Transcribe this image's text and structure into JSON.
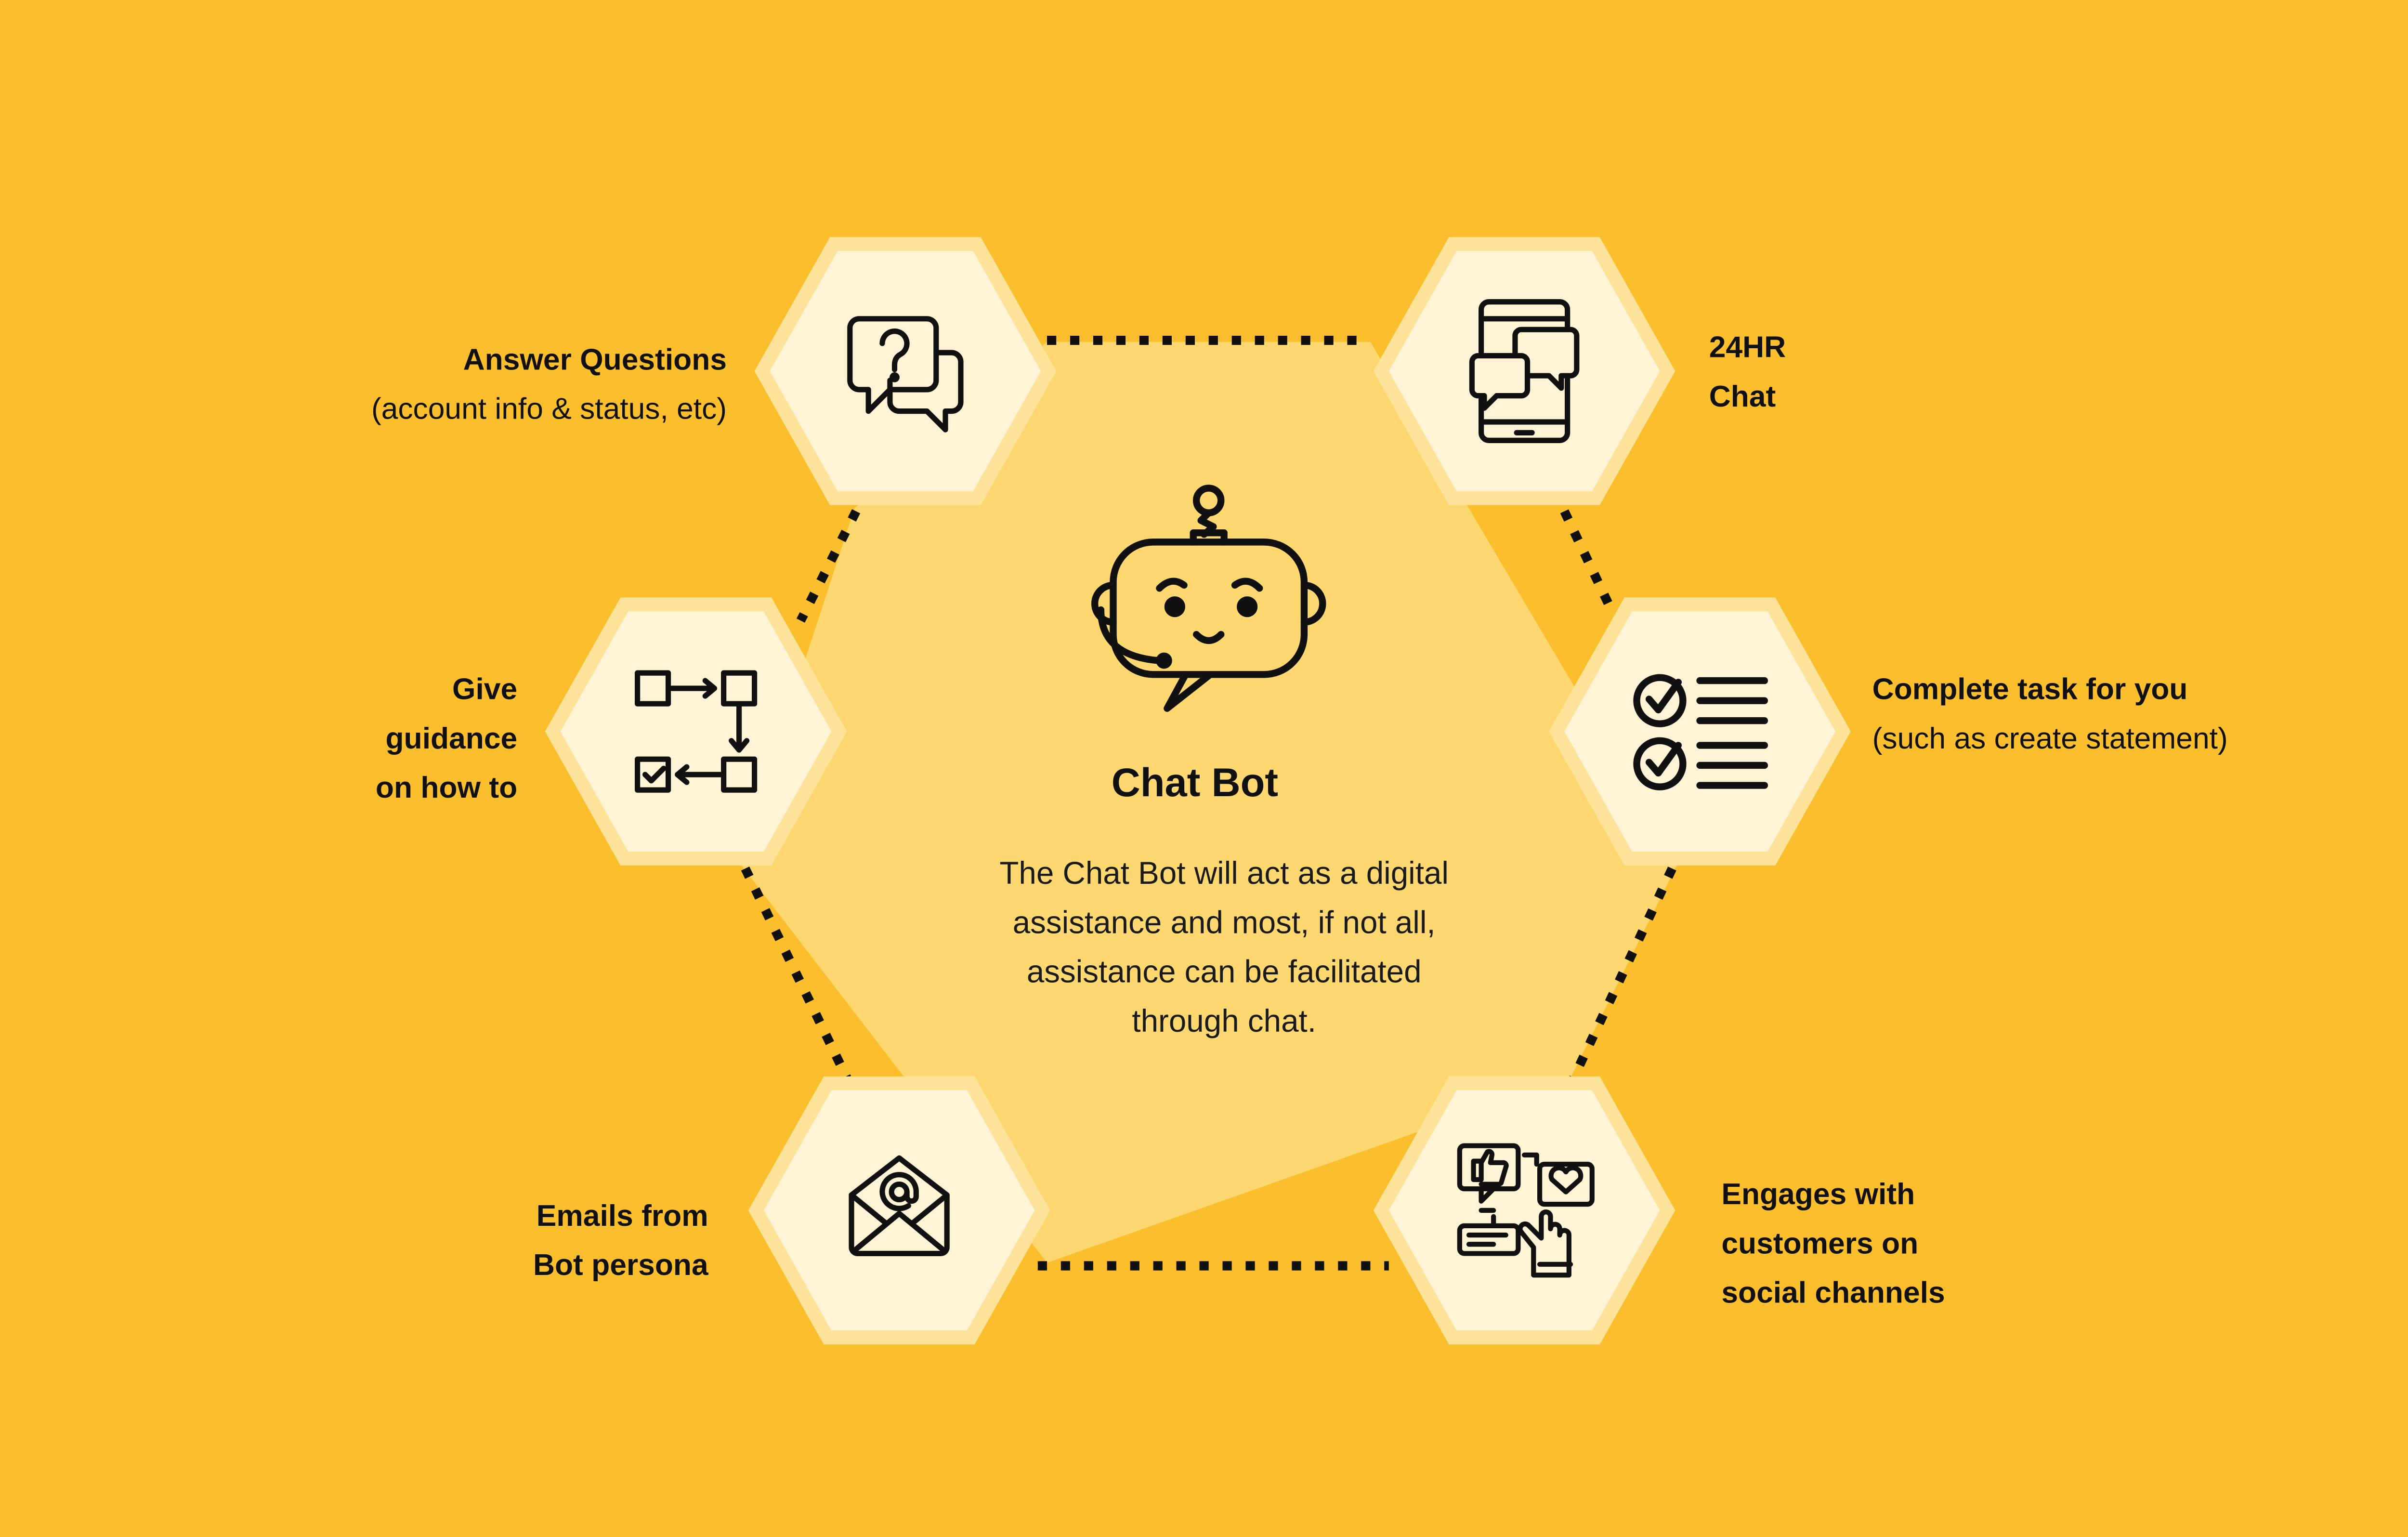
{
  "colors": {
    "background": "#FBBE2D",
    "center_hexagon": "#FDD871",
    "node_ring": "#FDE39A",
    "node_fill": "#FFF4D6",
    "ink": "#111111"
  },
  "center": {
    "title": "Chat Bot",
    "description_lines": [
      "The Chat Bot will act as a digital",
      "assistance and most, if not all,",
      "assistance can be facilitated",
      "through chat."
    ],
    "icon": "robot-headset-icon"
  },
  "nodes": [
    {
      "id": "answer-questions",
      "icon": "question-chat-bubbles-icon",
      "title_lines": [
        "Answer Questions"
      ],
      "subtitle_lines": [
        "(account info & status, etc)"
      ]
    },
    {
      "id": "24hr-chat",
      "icon": "phone-chat-icon",
      "title_lines": [
        "24HR",
        "Chat"
      ],
      "subtitle_lines": []
    },
    {
      "id": "give-guidance",
      "icon": "flowchart-icon",
      "title_lines": [
        "Give",
        "guidance",
        "on how to"
      ],
      "subtitle_lines": []
    },
    {
      "id": "complete-task",
      "icon": "checklist-icon",
      "title_lines": [
        "Complete task for you"
      ],
      "subtitle_lines": [
        "(such as create statement)"
      ]
    },
    {
      "id": "emails",
      "icon": "email-envelope-icon",
      "title_lines": [
        "Emails from",
        "Bot persona"
      ],
      "subtitle_lines": []
    },
    {
      "id": "social",
      "icon": "social-engagement-icon",
      "title_lines": [
        "Engages with",
        "customers on",
        "social channels"
      ],
      "subtitle_lines": []
    }
  ]
}
